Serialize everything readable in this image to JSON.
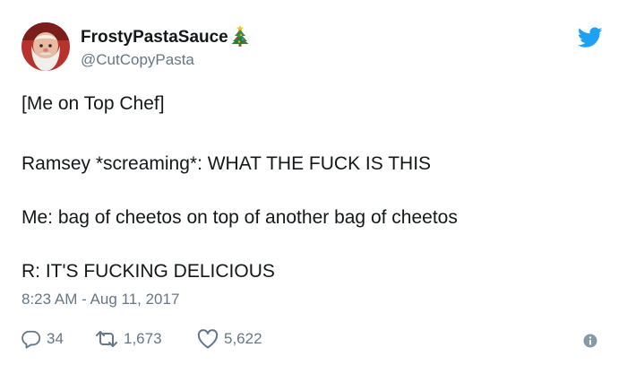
{
  "user": {
    "display_name": "FrostyPastaSauce",
    "handle": "@CutCopyPasta",
    "name_emoji": "christmas-tree-icon"
  },
  "tweet": {
    "lines": [
      "[Me on Top Chef]",
      "Ramsey *screaming*: WHAT THE FUCK IS THIS",
      "Me: bag of cheetos on top of another bag of cheetos",
      "R: IT'S FUCKING DELICIOUS"
    ],
    "timestamp": "8:23 AM - Aug 11, 2017"
  },
  "actions": {
    "reply_count": "34",
    "retweet_count": "1,673",
    "like_count": "5,622"
  },
  "colors": {
    "text": "#14171a",
    "secondary": "#657786",
    "twitter_blue": "#1da1f2"
  },
  "icons": {
    "brand": "twitter-bird-icon",
    "reply": "reply-icon",
    "retweet": "retweet-icon",
    "like": "heart-icon",
    "info": "info-icon"
  }
}
